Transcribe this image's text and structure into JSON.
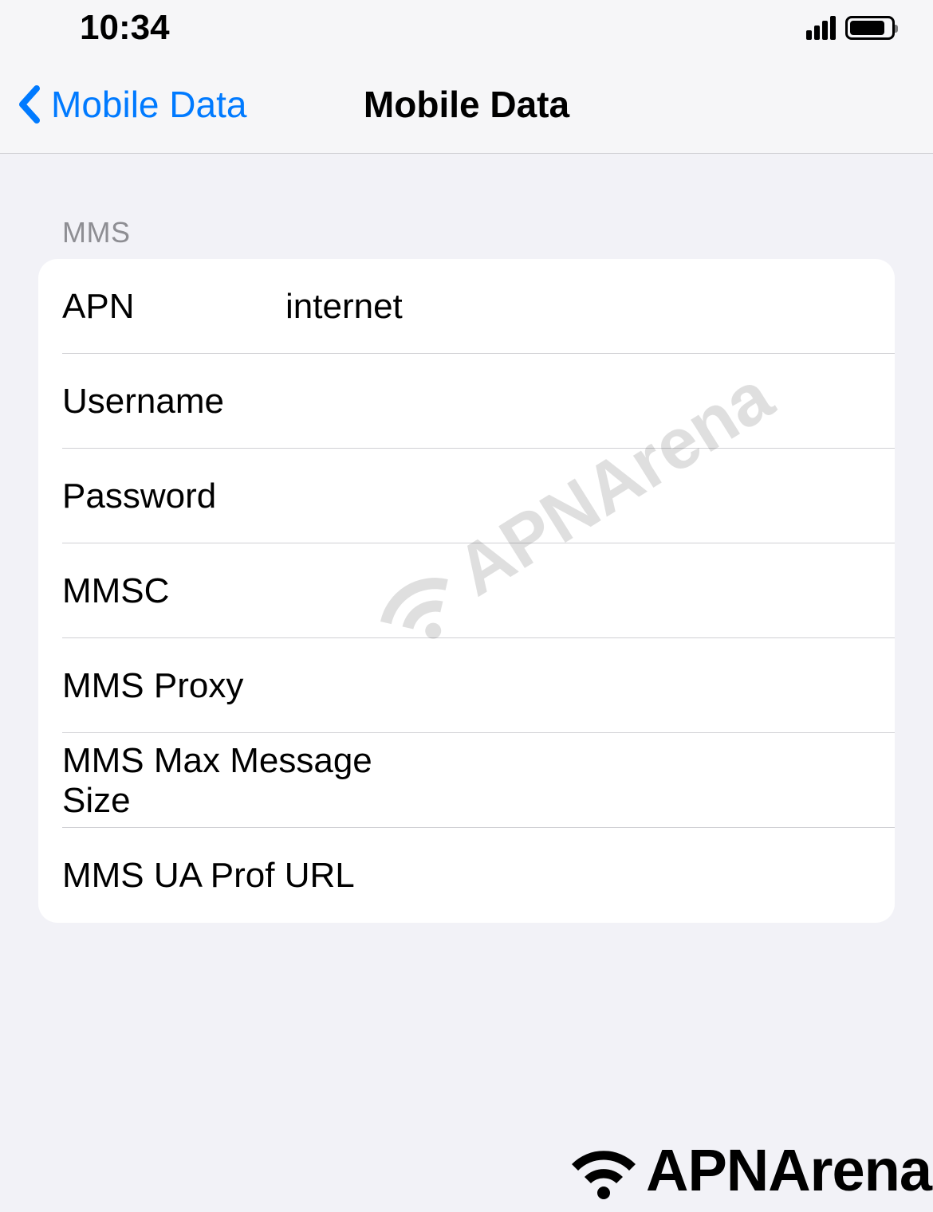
{
  "status_bar": {
    "time": "10:34"
  },
  "nav": {
    "back_label": "Mobile Data",
    "title": "Mobile Data"
  },
  "section": {
    "header": "MMS",
    "fields": {
      "apn": {
        "label": "APN",
        "value": "internet"
      },
      "username": {
        "label": "Username",
        "value": ""
      },
      "password": {
        "label": "Password",
        "value": ""
      },
      "mmsc": {
        "label": "MMSC",
        "value": ""
      },
      "mms_proxy": {
        "label": "MMS Proxy",
        "value": ""
      },
      "mms_max_size": {
        "label": "MMS Max Message Size",
        "value": ""
      },
      "mms_ua_prof": {
        "label": "MMS UA Prof URL",
        "value": ""
      }
    }
  },
  "watermark": {
    "text": "APNArena"
  }
}
